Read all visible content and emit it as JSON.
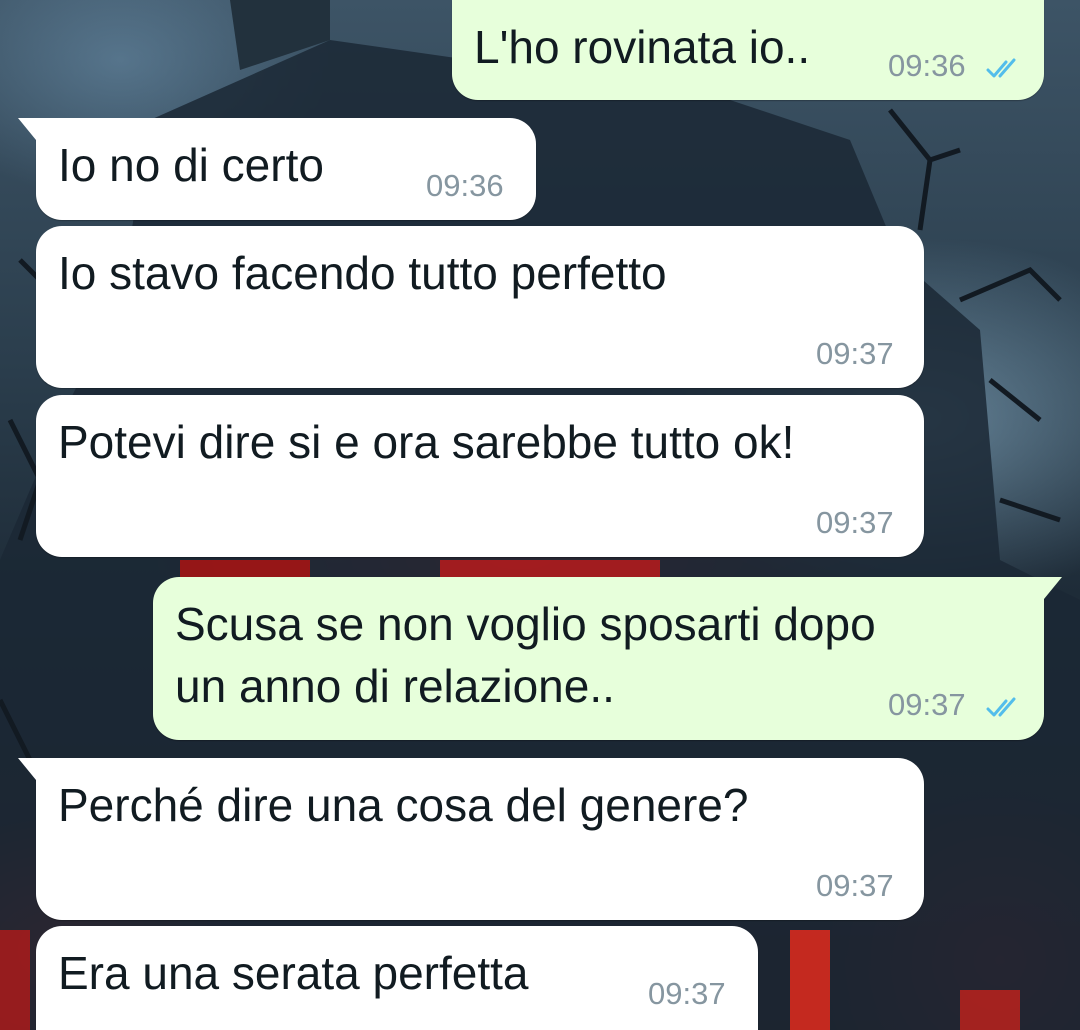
{
  "messages": [
    {
      "direction": "outgoing",
      "text": "L'ho rovinata io..",
      "time": "09:36",
      "status": "read",
      "status_icon": "double-check-icon"
    },
    {
      "direction": "incoming",
      "text": "Io no di certo",
      "time": "09:36"
    },
    {
      "direction": "incoming",
      "text": "Io stavo facendo tutto perfetto",
      "time": "09:37"
    },
    {
      "direction": "incoming",
      "text": "Potevi dire si e ora sarebbe tutto ok!",
      "time": "09:37"
    },
    {
      "direction": "outgoing",
      "text_lines": [
        "Scusa se non voglio sposarti dopo",
        "un anno di relazione.."
      ],
      "time": "09:37",
      "status": "read",
      "status_icon": "double-check-icon"
    },
    {
      "direction": "incoming",
      "text": "Perché dire una cosa del genere?",
      "time": "09:37"
    },
    {
      "direction": "incoming",
      "text": "Era una serata perfetta",
      "time": "09:37"
    }
  ],
  "colors": {
    "incoming_bubble": "#ffffff",
    "outgoing_bubble": "#e7ffdb",
    "text": "#111b21",
    "timestamp": "#8696a0",
    "read_ticks": "#53bdeb"
  },
  "wallpaper": "haunted-house-wallpaper"
}
